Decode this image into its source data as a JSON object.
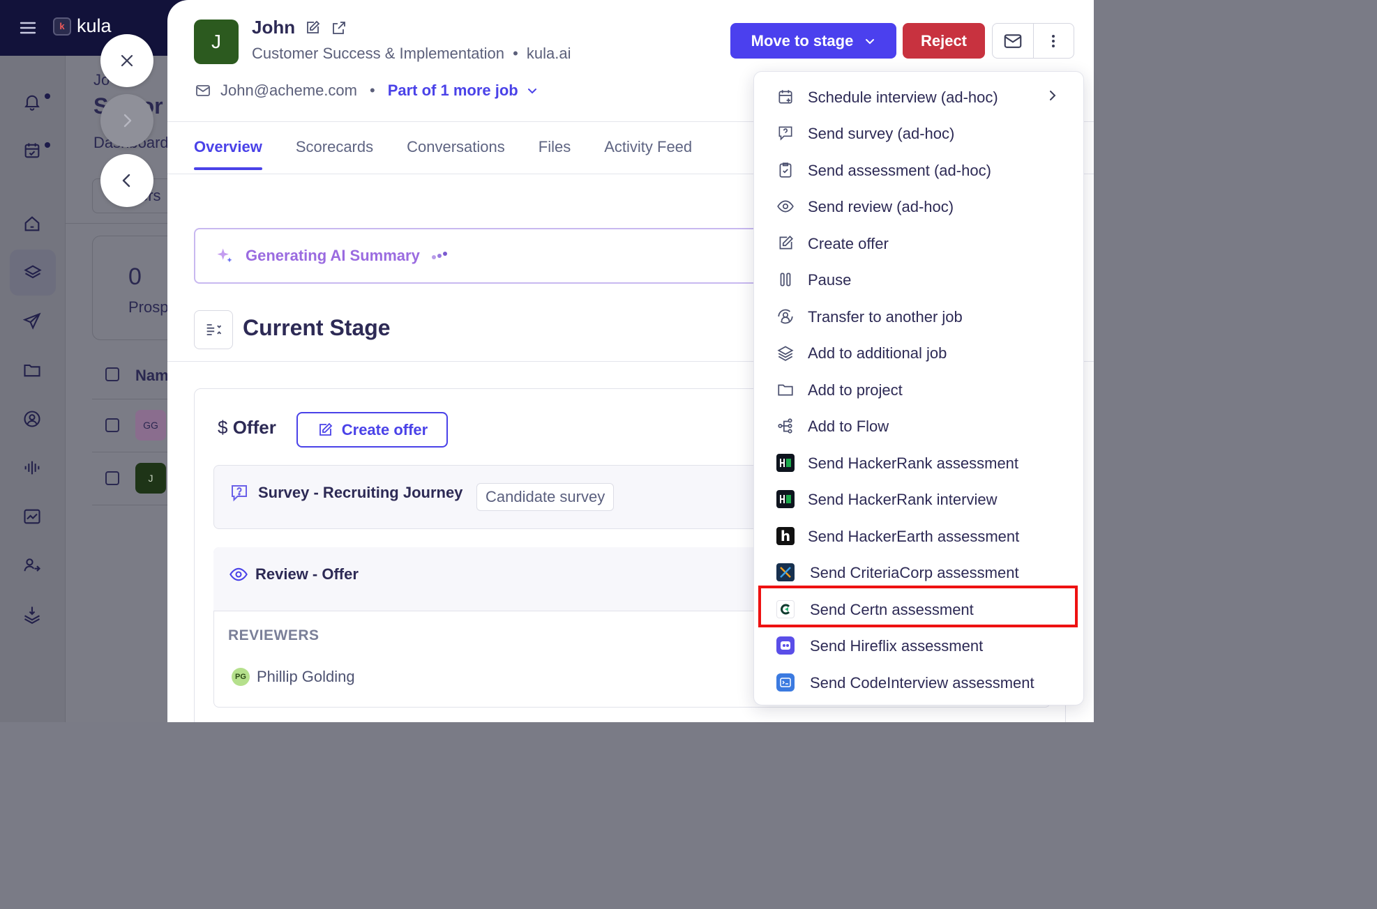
{
  "app": {
    "name": "kula"
  },
  "background": {
    "breadcrumb": "Jo",
    "title": "Senior",
    "subnav": "Dashboard",
    "filter_label": "ers",
    "prospects_count": "0",
    "prospects_label": "Prosp",
    "table_header": "Nam",
    "rows": [
      {
        "initials": "GG"
      },
      {
        "initials": "J"
      }
    ]
  },
  "candidate": {
    "initial": "J",
    "name": "John",
    "job": "Customer Success & Implementation",
    "company": "kula.ai",
    "email": "John@acheme.com",
    "more_jobs": "Part of 1 more job"
  },
  "actions": {
    "move_to_stage": "Move to stage",
    "reject": "Reject"
  },
  "tabs": [
    {
      "label": "Overview",
      "active": true
    },
    {
      "label": "Scorecards"
    },
    {
      "label": "Conversations"
    },
    {
      "label": "Files"
    },
    {
      "label": "Activity Feed"
    }
  ],
  "ai_summary": {
    "label": "Generating AI Summary"
  },
  "current_stage": {
    "title": "Current Stage",
    "offer_label": "Offer",
    "create_offer_button": "Create offer",
    "survey": {
      "title": "Survey - Recruiting Journey",
      "tag": "Candidate survey"
    },
    "review": {
      "title": "Review - Offer",
      "reviewers_label": "REVIEWERS",
      "reviewer": {
        "initials": "PG",
        "name": "Phillip Golding"
      }
    }
  },
  "menu": {
    "items": [
      {
        "label": "Schedule interview (ad-hoc)",
        "icon": "calendar-plus-icon",
        "has_submenu": true
      },
      {
        "label": "Send survey (ad-hoc)",
        "icon": "survey-icon"
      },
      {
        "label": "Send assessment (ad-hoc)",
        "icon": "clipboard-check-icon"
      },
      {
        "label": "Send review (ad-hoc)",
        "icon": "eye-icon"
      },
      {
        "label": "Create offer",
        "icon": "edit-icon"
      },
      {
        "label": "Pause",
        "icon": "pause-icon"
      },
      {
        "label": "Transfer to another job",
        "icon": "transfer-icon"
      },
      {
        "label": "Add to additional job",
        "icon": "layers-icon"
      },
      {
        "label": "Add to project",
        "icon": "folder-icon"
      },
      {
        "label": "Add to Flow",
        "icon": "flow-icon"
      },
      {
        "label": "Send HackerRank assessment",
        "icon": "hackerrank-logo"
      },
      {
        "label": "Send HackerRank interview",
        "icon": "hackerrank-logo"
      },
      {
        "label": "Send HackerEarth assessment",
        "icon": "hackerearth-logo"
      },
      {
        "label": "Send CriteriaCorp assessment",
        "icon": "criteriacorp-logo"
      },
      {
        "label": "Send Certn assessment",
        "icon": "certn-logo",
        "highlighted": true
      },
      {
        "label": "Send Hireflix assessment",
        "icon": "hireflix-logo"
      },
      {
        "label": "Send CodeInterview assessment",
        "icon": "codeinterview-logo"
      }
    ]
  },
  "colors": {
    "primary": "#4b40ee",
    "danger": "#c8323f",
    "topbar": "#12123a",
    "highlight": "#ee1111",
    "ai_accent": "#9a6be0"
  }
}
